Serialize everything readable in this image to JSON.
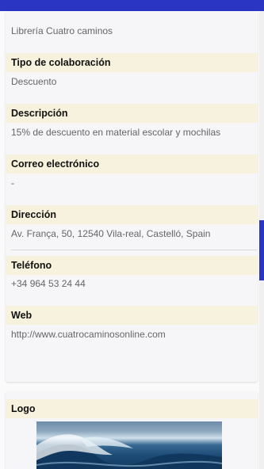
{
  "colors": {
    "accent": "#2b35c4",
    "label_background": "#f6f2dd",
    "card_background": "#f6f5f8"
  },
  "business": {
    "name_value": "Librería Cuatro caminos"
  },
  "fields": [
    {
      "label": "Tipo de colaboración",
      "value": "Descuento"
    },
    {
      "label": "Descripción",
      "value": "15% de descuento en material escolar y mochilas"
    },
    {
      "label": "Correo electrónico",
      "value": "-"
    },
    {
      "label": "Dirección",
      "value": "Av. França, 50, 12540 Vila-real, Castelló, Spain"
    },
    {
      "label": "Teléfono",
      "value": "+34 964 53 24 44"
    },
    {
      "label": "Web",
      "value": "http://www.cuatrocaminosonline.com"
    }
  ],
  "logo_section": {
    "label": "Logo",
    "image_icon": "wave-photo"
  }
}
